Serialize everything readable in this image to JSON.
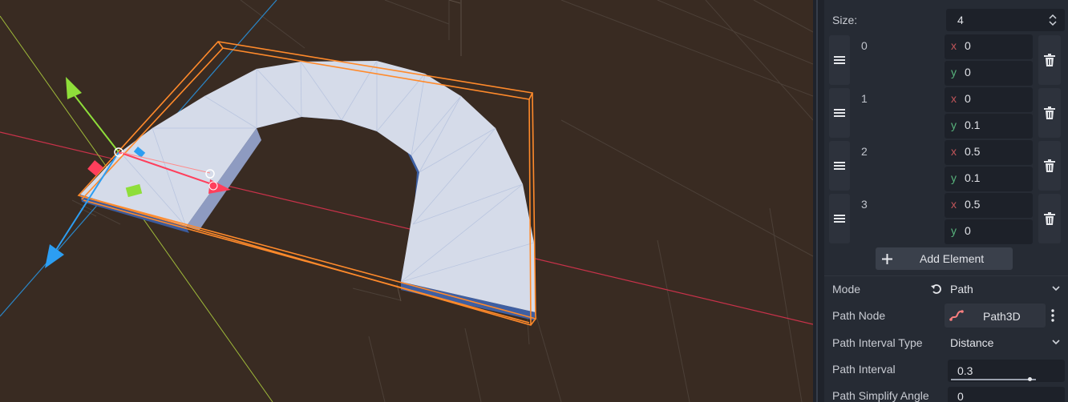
{
  "viewport": {
    "colors": {
      "background": "#392b22",
      "mesh_top": "#d5dbe9",
      "mesh_side": "#3d5fa3",
      "selection": "#ff8a2b",
      "x_axis": "#ff3f5c",
      "y_axis": "#8fde3a",
      "z_axis": "#2c9ef2"
    }
  },
  "inspector": {
    "size_label": "Size:",
    "size_value": "4",
    "elements": [
      {
        "index": "0",
        "x": "0",
        "y": "0"
      },
      {
        "index": "1",
        "x": "0",
        "y": "0.1"
      },
      {
        "index": "2",
        "x": "0.5",
        "y": "0.1"
      },
      {
        "index": "3",
        "x": "0.5",
        "y": "0"
      }
    ],
    "x_axis_label": "x",
    "y_axis_label": "y",
    "add_element_label": "Add Element",
    "mode_label": "Mode",
    "mode_value": "Path",
    "path_node_label": "Path Node",
    "path_node_value": "Path3D",
    "path_interval_type_label": "Path Interval Type",
    "path_interval_type_value": "Distance",
    "path_interval_label": "Path Interval",
    "path_interval_value": "0.3",
    "path_interval_slider_fraction": 0.84,
    "path_simplify_angle_label": "Path Simplify Angle",
    "path_simplify_angle_value": "0"
  }
}
